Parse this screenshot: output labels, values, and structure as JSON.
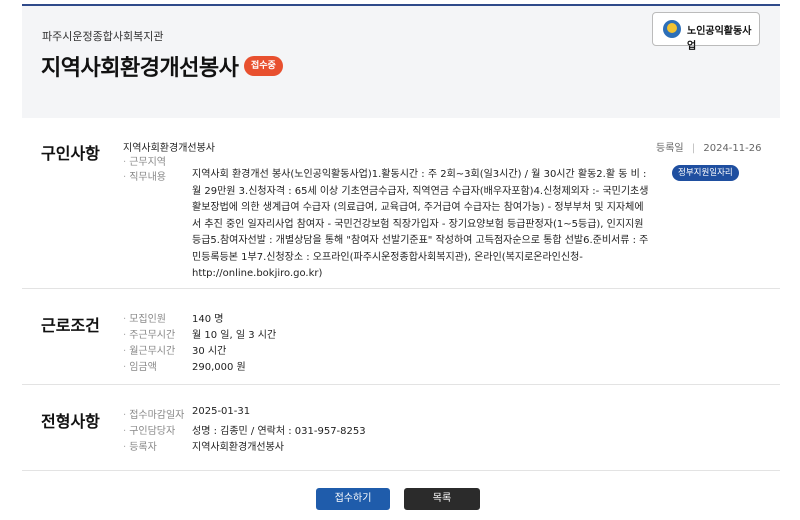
{
  "header": {
    "org_name": "파주시운정종합사회복지관",
    "title": "지역사회환경개선봉사",
    "status_badge": "접수중",
    "logo_text": "노인공익활동사업"
  },
  "recruit": {
    "section_title": "구인사항",
    "job_name": "지역사회환경개선봉사",
    "registered_label": "등록일",
    "registered_date": "2024-11-26",
    "gov_badge": "정부지원일자리",
    "work_area_label": "근무지역",
    "duties_label": "직무내용",
    "duties_text": "지역사회 환경개선 봉사(노인공익활동사업)1.활동시간 : 주 2회~3회(일3시간) / 월 30시간 활동2.활 동 비 : 월 29만원 3.신청자격 : 65세 이상 기초연금수급자, 직역연금 수급자(배우자포함)4.신청제외자 :- 국민기초생활보장법에 의한 생계급여 수급자 (의료급여, 교육급여, 주거급여 수급자는 참여가능) - 정부부처 및 지자체에서 추진 중인 일자리사업 참여자 - 국민건강보험 직장가입자 - 장기요양보험 등급판정자(1~5등급), 인지지원등급5.참여자선발 : 개별상담을 통해 \"참여자 선발기준표\" 작성하여 고득점자순으로 통합 선발6.준비서류 : 주민등록등본 1부7.신청장소 : 오프라인(파주시운정종합사회복지관), 온라인(복지로온라인신청-http://online.bokjiro.go.kr)"
  },
  "conditions": {
    "section_title": "근로조건",
    "rows": [
      {
        "label": "모집인원",
        "value": "140 명"
      },
      {
        "label": "주근무시간",
        "value": "월 10 일, 일 3 시간"
      },
      {
        "label": "월근무시간",
        "value": "30 시간"
      },
      {
        "label": "임금액",
        "value": "290,000 원"
      }
    ]
  },
  "selection": {
    "section_title": "전형사항",
    "rows": [
      {
        "label": "접수마감일자",
        "value": "2025-01-31"
      },
      {
        "label": "구인담당자",
        "value": "성명 : 김종민 / 연락처 : 031-957-8253"
      },
      {
        "label": "등록자",
        "value": "지역사회환경개선봉사"
      }
    ]
  },
  "buttons": {
    "apply": "접수하기",
    "list": "목록"
  }
}
